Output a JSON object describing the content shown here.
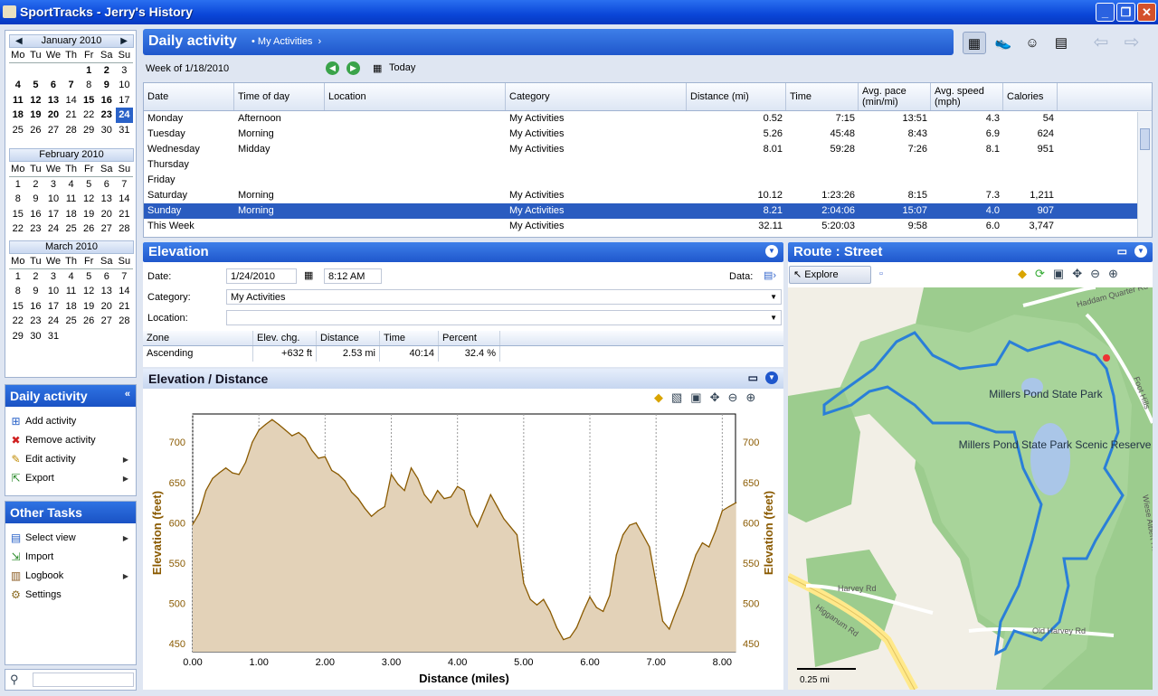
{
  "window": {
    "title": "SportTracks - Jerry's History"
  },
  "calendar": {
    "months": [
      {
        "name": "January 2010",
        "days": [
          [
            "",
            "",
            "",
            "",
            "1",
            "2",
            "3"
          ],
          [
            "4",
            "5",
            "6",
            "7",
            "8",
            "9",
            "10"
          ],
          [
            "11",
            "12",
            "13",
            "14",
            "15",
            "16",
            "17"
          ],
          [
            "18",
            "19",
            "20",
            "21",
            "22",
            "23",
            "24"
          ],
          [
            "25",
            "26",
            "27",
            "28",
            "29",
            "30",
            "31"
          ]
        ],
        "bold": [
          "1",
          "2",
          "4",
          "5",
          "6",
          "7",
          "9",
          "11",
          "12",
          "13",
          "15",
          "16",
          "18",
          "19",
          "20",
          "23"
        ],
        "selected": "24"
      },
      {
        "name": "February 2010",
        "days": [
          [
            "1",
            "2",
            "3",
            "4",
            "5",
            "6",
            "7"
          ],
          [
            "8",
            "9",
            "10",
            "11",
            "12",
            "13",
            "14"
          ],
          [
            "15",
            "16",
            "17",
            "18",
            "19",
            "20",
            "21"
          ],
          [
            "22",
            "23",
            "24",
            "25",
            "26",
            "27",
            "28"
          ]
        ],
        "bold": [],
        "selected": ""
      },
      {
        "name": "March 2010",
        "days": [
          [
            "1",
            "2",
            "3",
            "4",
            "5",
            "6",
            "7"
          ],
          [
            "8",
            "9",
            "10",
            "11",
            "12",
            "13",
            "14"
          ],
          [
            "15",
            "16",
            "17",
            "18",
            "19",
            "20",
            "21"
          ],
          [
            "22",
            "23",
            "24",
            "25",
            "26",
            "27",
            "28"
          ],
          [
            "29",
            "30",
            "31",
            "",
            "",
            "",
            ""
          ]
        ],
        "bold": [],
        "selected": ""
      }
    ],
    "weekdays": [
      "Mo",
      "Tu",
      "We",
      "Th",
      "Fr",
      "Sa",
      "Su"
    ]
  },
  "daily_panel": {
    "title": "Daily activity",
    "items": [
      {
        "label": "Add activity",
        "icon": "add-icon",
        "sub": false
      },
      {
        "label": "Remove activity",
        "icon": "remove-icon",
        "sub": false
      },
      {
        "label": "Edit activity",
        "icon": "pencil-icon",
        "sub": true
      },
      {
        "label": "Export",
        "icon": "export-icon",
        "sub": true
      }
    ]
  },
  "other_panel": {
    "title": "Other Tasks",
    "items": [
      {
        "label": "Select view",
        "icon": "view-icon",
        "sub": true
      },
      {
        "label": "Import",
        "icon": "import-icon",
        "sub": false
      },
      {
        "label": "Logbook",
        "icon": "logbook-icon",
        "sub": true
      },
      {
        "label": "Settings",
        "icon": "settings-icon",
        "sub": false
      }
    ]
  },
  "header": {
    "title": "Daily activity",
    "crumb": "My Activities"
  },
  "week": {
    "label": "Week of 1/18/2010",
    "today": "Today"
  },
  "table": {
    "columns": [
      "Date",
      "Time of day",
      "Location",
      "Category",
      "Distance (mi)",
      "Time",
      "Avg. pace (min/mi)",
      "Avg. speed (mph)",
      "Calories"
    ],
    "rows": [
      [
        "Monday",
        "Afternoon",
        "",
        "My Activities",
        "0.52",
        "7:15",
        "13:51",
        "4.3",
        "54"
      ],
      [
        "Tuesday",
        "Morning",
        "",
        "My Activities",
        "5.26",
        "45:48",
        "8:43",
        "6.9",
        "624"
      ],
      [
        "Wednesday",
        "Midday",
        "",
        "My Activities",
        "8.01",
        "59:28",
        "7:26",
        "8.1",
        "951"
      ],
      [
        "Thursday",
        "",
        "",
        "",
        "",
        "",
        "",
        "",
        ""
      ],
      [
        "Friday",
        "",
        "",
        "",
        "",
        "",
        "",
        "",
        ""
      ],
      [
        "Saturday",
        "Morning",
        "",
        "My Activities",
        "10.12",
        "1:23:26",
        "8:15",
        "7.3",
        "1,211"
      ],
      [
        "Sunday",
        "Morning",
        "",
        "My Activities",
        "8.21",
        "2:04:06",
        "15:07",
        "4.0",
        "907"
      ],
      [
        "This Week",
        "",
        "",
        "My Activities",
        "32.11",
        "5:20:03",
        "9:58",
        "6.0",
        "3,747"
      ]
    ],
    "selected_row": 6
  },
  "elevation": {
    "title": "Elevation",
    "date_label": "Date:",
    "date": "1/24/2010",
    "time": "8:12 AM",
    "data_label": "Data:",
    "category_label": "Category:",
    "category": "My Activities",
    "location_label": "Location:",
    "location": "",
    "zone_columns": [
      "Zone",
      "Elev. chg.",
      "Distance",
      "Time",
      "Percent"
    ],
    "zone_row": [
      "Ascending",
      "+632 ft",
      "2.53 mi",
      "40:14",
      "32.4 %"
    ]
  },
  "chart_panel": {
    "title": "Elevation / Distance"
  },
  "chart_data": {
    "type": "area",
    "xlabel": "Distance (miles)",
    "ylabel": "Elevation (feet)",
    "xlim": [
      0,
      8.2
    ],
    "ylim": [
      440,
      735
    ],
    "xticks": [
      "0.00",
      "1.00",
      "2.00",
      "3.00",
      "4.00",
      "5.00",
      "6.00",
      "7.00",
      "8.00"
    ],
    "yticks": [
      "450",
      "500",
      "550",
      "600",
      "650",
      "700"
    ],
    "x": [
      0,
      0.1,
      0.2,
      0.3,
      0.4,
      0.5,
      0.6,
      0.7,
      0.8,
      0.9,
      1.0,
      1.1,
      1.2,
      1.3,
      1.4,
      1.5,
      1.6,
      1.7,
      1.8,
      1.9,
      2.0,
      2.1,
      2.2,
      2.3,
      2.4,
      2.5,
      2.6,
      2.7,
      2.8,
      2.9,
      3.0,
      3.1,
      3.2,
      3.3,
      3.4,
      3.5,
      3.6,
      3.7,
      3.8,
      3.9,
      4.0,
      4.1,
      4.2,
      4.3,
      4.4,
      4.5,
      4.6,
      4.7,
      4.8,
      4.9,
      5.0,
      5.1,
      5.2,
      5.3,
      5.4,
      5.5,
      5.6,
      5.7,
      5.8,
      5.9,
      6.0,
      6.1,
      6.2,
      6.3,
      6.4,
      6.5,
      6.6,
      6.7,
      6.8,
      6.9,
      7.0,
      7.1,
      7.2,
      7.3,
      7.4,
      7.5,
      7.6,
      7.7,
      7.8,
      7.9,
      8.0,
      8.1,
      8.21
    ],
    "y": [
      598,
      612,
      640,
      655,
      662,
      668,
      662,
      660,
      675,
      700,
      715,
      722,
      728,
      722,
      715,
      708,
      712,
      705,
      690,
      680,
      682,
      665,
      660,
      652,
      638,
      630,
      618,
      608,
      615,
      620,
      660,
      648,
      640,
      668,
      655,
      635,
      625,
      640,
      630,
      632,
      645,
      640,
      610,
      595,
      615,
      635,
      620,
      605,
      595,
      585,
      525,
      505,
      498,
      505,
      490,
      470,
      455,
      458,
      470,
      490,
      508,
      495,
      490,
      510,
      560,
      585,
      597,
      600,
      585,
      570,
      525,
      478,
      468,
      490,
      510,
      535,
      560,
      575,
      570,
      590,
      615,
      620,
      625
    ]
  },
  "route": {
    "title": "Route : Street",
    "explore": "Explore",
    "labels": [
      "Haddam Quarter Rd",
      "Millers Pond State Park",
      "Millers Pond State Park Scenic Reserve",
      "Harvey Rd",
      "Higganum Rd",
      "Old Harvey Rd",
      "Foot Hills",
      "Wiese Albert Rd"
    ],
    "scale": "0.25 mi"
  }
}
